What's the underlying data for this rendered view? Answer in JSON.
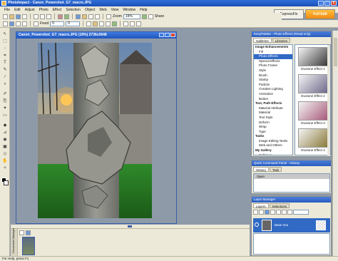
{
  "window": {
    "title": "PhotoImpact - Canon_Powershot_G7_macro.JPG",
    "min": "_",
    "max": "□",
    "close": "x"
  },
  "menu": [
    "File",
    "Edit",
    "Adjust",
    "Photo",
    "Effect",
    "Selection",
    "Object",
    "Web",
    "View",
    "Window",
    "Help"
  ],
  "modes": {
    "expresso": "ExpressFix",
    "fulledit": "Full Edit"
  },
  "toolbar": {
    "zoom_label": "Zoom",
    "zoom_value": "19%",
    "share": "Share",
    "fixed_label": "Fixed",
    "fixed_value": "0",
    "fixed_value2": "0"
  },
  "document": {
    "title": "Canon_Powershot_G7_macro.JPG (19%) 2736x3648"
  },
  "filmstrip": {
    "tab": "Document Manager"
  },
  "status": {
    "text": "For Help, press F1"
  },
  "easypalette": {
    "title": "EasyPalette - Photo Effects (Read-only)",
    "tabs": [
      "Galleries",
      "Libraries"
    ],
    "tree": [
      {
        "label": "Image Enhancements",
        "type": "cat"
      },
      {
        "label": "Fill",
        "type": "sub"
      },
      {
        "label": "Photo Effects",
        "type": "sub",
        "selected": true
      },
      {
        "label": "Special Effects",
        "type": "sub"
      },
      {
        "label": "Photo Frame",
        "type": "sub"
      },
      {
        "label": "Style",
        "type": "sub"
      },
      {
        "label": "Brush",
        "type": "sub"
      },
      {
        "label": "Stamp",
        "type": "sub"
      },
      {
        "label": "Particle",
        "type": "sub"
      },
      {
        "label": "Creative Lighting",
        "type": "sub"
      },
      {
        "label": "Animation",
        "type": "sub"
      },
      {
        "label": "Button",
        "type": "sub"
      },
      {
        "label": "Text, Path Effects",
        "type": "cat"
      },
      {
        "label": "Material Attribute",
        "type": "sub"
      },
      {
        "label": "Material",
        "type": "sub"
      },
      {
        "label": "Text Style",
        "type": "sub"
      },
      {
        "label": "Deform",
        "type": "sub"
      },
      {
        "label": "Wrap",
        "type": "sub"
      },
      {
        "label": "Type",
        "type": "sub"
      },
      {
        "label": "Tasks",
        "type": "cat"
      },
      {
        "label": "Image Editing Tasks",
        "type": "sub"
      },
      {
        "label": "Web and Others",
        "type": "sub"
      },
      {
        "label": "My Gallery",
        "type": "cat"
      },
      {
        "label": "Gallery 1",
        "type": "sub"
      }
    ],
    "gallery": [
      "Duotone Effect 1",
      "Duotone Effect 2",
      "Duotone Effect 3",
      "Duotone Effect 4"
    ],
    "thumb_colors": [
      "#3a3a3a",
      "#6f6a8a",
      "#a75a7a",
      "#8a7a3a"
    ]
  },
  "history": {
    "title": "Quick Command Panel - History",
    "tabs": [
      "History",
      "Task"
    ],
    "items": [
      "Open"
    ]
  },
  "layers": {
    "title": "Layer Manager",
    "tabs": [
      "Layers",
      "Selections"
    ],
    "row": {
      "name": "Base Ima"
    }
  }
}
